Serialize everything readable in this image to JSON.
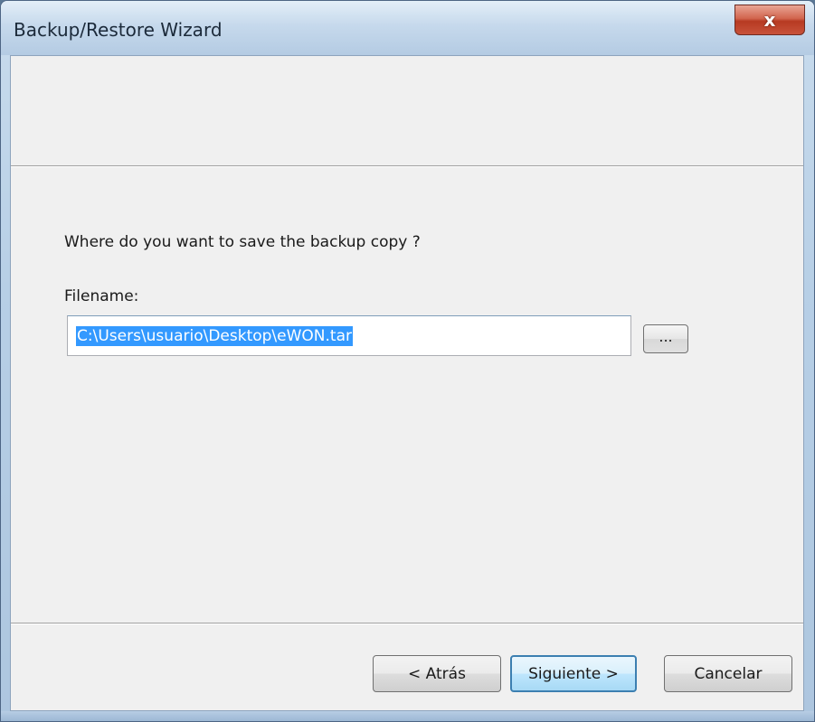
{
  "window": {
    "title": "Backup/Restore Wizard",
    "close_symbol": "x",
    "close_icon": "close-icon"
  },
  "content": {
    "question": "Where do you want to save the backup copy ?",
    "filename_label": "Filename:",
    "filename_value": "C:\\Users\\usuario\\Desktop\\eWON.tar",
    "browse_label": "..."
  },
  "buttons": {
    "back": "< Atrás",
    "next": "Siguiente >",
    "cancel": "Cancelar"
  },
  "colors": {
    "selection": "#3399ff",
    "close_button": "#c8523a",
    "default_button_border": "#3c7fb1"
  }
}
